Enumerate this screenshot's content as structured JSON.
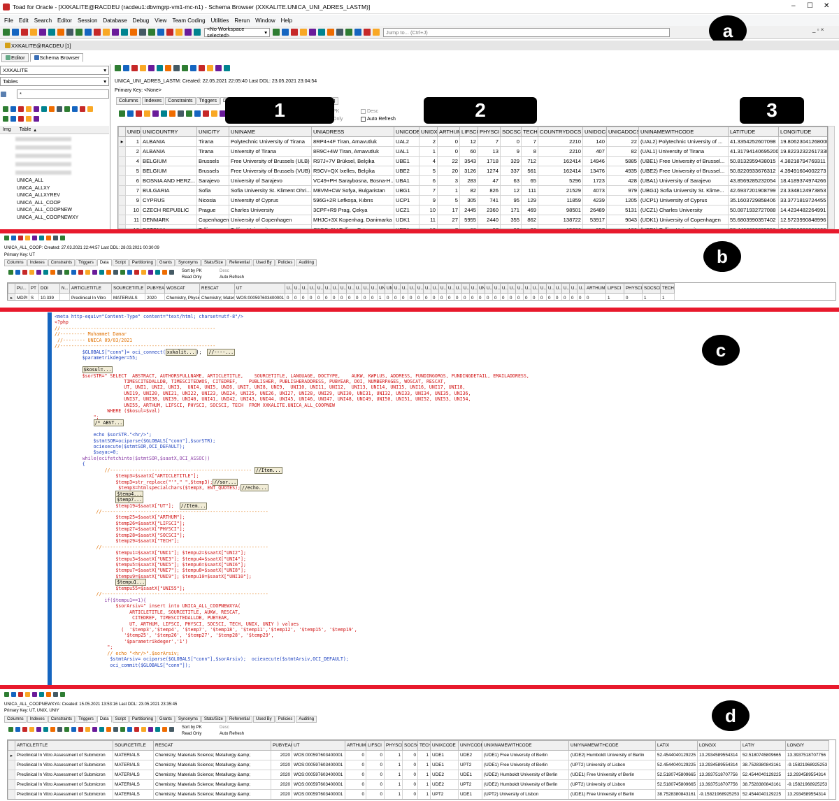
{
  "window": {
    "title": "Toad for Oracle - [XXKALITE@RACDEU (racdeu1:dbvmgrp-vm1-mc-n1) - Schema Browser (XXKALITE.UNICA_UNI_ADRES_LASTM)]",
    "controls": [
      "–",
      "☐",
      "✕"
    ]
  },
  "menu": [
    "File",
    "Edit",
    "Search",
    "Editor",
    "Session",
    "Database",
    "Debug",
    "View",
    "Team Coding",
    "Utilities",
    "Rerun",
    "Window",
    "Help"
  ],
  "toolbar": {
    "workspace": "<No Workspace selected>",
    "jump_placeholder": "Jump to... (Ctrl+J)"
  },
  "connection_tab": "XXKALITE@RACDEU [1]",
  "doc_tabs": [
    "Editor",
    "Schema Browser"
  ],
  "left": {
    "schema": "XXKALITE",
    "object_type": "Tables",
    "filter": "*",
    "col_img": "Img",
    "col_table": "Table",
    "tables": [
      "UNICA_ALL",
      "UNICA_ALLXY",
      "UNICA_ALLXYREV",
      "UNICA_ALL_COOP",
      "UNICA_ALL_COOPNEW",
      "UNICA_ALL_COOPNEWXY"
    ]
  },
  "labels": {
    "a": "a",
    "b": "b",
    "c": "c",
    "d": "d",
    "one": "1",
    "two": "2",
    "three": "3"
  },
  "panel_a": {
    "object": "UNICA_UNI_ADRES_LASTM:",
    "created": "Created: 22.05.2021 22:05:40",
    "ddl": "Last DDL: 23.05.2021 23:04:54",
    "pk": "Primary Key: <None>",
    "tabs": [
      "Columns",
      "Indexes",
      "Constraints",
      "Triggers",
      "Data",
      "Referential",
      "Used By",
      "Policies",
      "Auditing"
    ],
    "opt_pk": "PK",
    "opt_readonly": "Only",
    "opt_desc": "Desc",
    "opt_refresh": "Auto Refresh",
    "columns": [
      "UNID",
      "UNICOUNTRY",
      "UNICITY",
      "UNINAME",
      "UNIADRESS",
      "UNICODE",
      "UNIDX",
      "ARTHUM",
      "LIFSCI",
      "PHYSCI",
      "SOCSCI",
      "TECH",
      "COUNTRYDOCS",
      "UNIDOCS",
      "UNICADOCS",
      "UNINAMEWITHCODE",
      "LATITUDE",
      "LONGITUDE"
    ],
    "rows": [
      [
        "1",
        "ALBANIA",
        "Tirana",
        "Polytechnic University of Tirana",
        "8RP4+4F Tiran, Arnavutluk",
        "UAL2",
        "2",
        "0",
        "12",
        "7",
        "0",
        "7",
        "2210",
        "140",
        "22",
        "(UAL2) Polytechnic University of ...",
        "41.3354252607098",
        "19.80623041268000"
      ],
      [
        "2",
        "ALBANIA",
        "Tirana",
        "University of Tirana",
        "8R9C+4W Tiran, Arnavutluk",
        "UAL1",
        "1",
        "0",
        "60",
        "13",
        "9",
        "8",
        "2210",
        "407",
        "82",
        "(UAL1) University of Tirana",
        "41.31794140695200",
        "19.82232322617330"
      ],
      [
        "4",
        "BELGIUM",
        "Brussels",
        "Free University of Brussels (ULB)",
        "R97J+7V Brüksel, Belçika",
        "UBE1",
        "4",
        "22",
        "3543",
        "1718",
        "329",
        "712",
        "162414",
        "14946",
        "5885",
        "(UBE1) Free University of Brussel...",
        "50.8132959438015",
        "4.38218794769311"
      ],
      [
        "5",
        "BELGIUM",
        "Brussels",
        "Free University of Brussels (VUB)",
        "R9CV+QX Ixelles, Belçika",
        "UBE2",
        "5",
        "20",
        "3126",
        "1274",
        "337",
        "561",
        "162414",
        "13476",
        "4935",
        "(UBE2) Free University of Brussel...",
        "50.8220933676312",
        "4.39491604002273"
      ],
      [
        "6",
        "BOSNIA AND HERZ...",
        "Sarajevo",
        "University of Sarajevo",
        "VC49+PH Saraybosna, Bosna-H...",
        "UBA1",
        "6",
        "3",
        "283",
        "47",
        "63",
        "65",
        "5296",
        "1723",
        "428",
        "(UBA1) University of Sarajevo",
        "43.8569285232054",
        "18.4189374974266"
      ],
      [
        "7",
        "BULGARIA",
        "Sofia",
        "Sofia University St. Kliment Ohri...",
        "M8VM+CW Sofya, Bulgaristan",
        "UBG1",
        "7",
        "1",
        "82",
        "826",
        "12",
        "111",
        "21529",
        "4073",
        "979",
        "(UBG1) Sofia University St. Klime...",
        "42.6937201908799",
        "23.3348124973853"
      ],
      [
        "9",
        "CYPRUS",
        "Nicosia",
        "University of Cyprus",
        "596G+2R Lefkoşa, Kıbrıs",
        "UCP1",
        "9",
        "5",
        "305",
        "741",
        "95",
        "129",
        "11859",
        "4239",
        "1205",
        "(UCP1) University of Cyprus",
        "35.1603729858406",
        "33.3771819724455"
      ],
      [
        "10",
        "CZECH REPUBLIC",
        "Prague",
        "Charles University",
        "3CPF+R9 Prag, Çekya",
        "UCZ1",
        "10",
        "17",
        "2445",
        "2360",
        "171",
        "469",
        "98501",
        "26489",
        "5131",
        "(UCZ1) Charles University",
        "50.0871932727088",
        "14.4234482264991"
      ],
      [
        "11",
        "DENMARK",
        "Copenhagen",
        "University of Copenhagen",
        "MHJC+3X Kopenhag, Danimarka",
        "UDK1",
        "11",
        "27",
        "5955",
        "2440",
        "355",
        "862",
        "138722",
        "53917",
        "9043",
        "(UDK1) University of Copenhagen",
        "55.6803990357402",
        "12.5723990848996"
      ],
      [
        "12",
        "ESTONIA",
        "Tallinn",
        "Tallinn University",
        "C9QC+5H Tallinn, Estonya",
        "UEE1",
        "12",
        "7",
        "68",
        "27",
        "90",
        "22",
        "15236",
        "957",
        "186",
        "(UEE1) Tallinn University",
        "59.4460003295556",
        "24.7713299366630"
      ]
    ]
  },
  "panel_b": {
    "object": "UNICA_ALL_COOP:",
    "created": "Created: 27.03.2021 22:44:57",
    "ddl": "Last DDL: 28.03.2021 00:30:09",
    "pk": "Primary Key: UT",
    "tabs": [
      "Columns",
      "Indexes",
      "Constraints",
      "Triggers",
      "Data",
      "Script",
      "Partitioning",
      "Grants",
      "Synonyms",
      "Stats/Size",
      "Referential",
      "Used By",
      "Policies",
      "Auditing"
    ],
    "opt_sortpk": "Sort by PK",
    "opt_readonly": "Read Only",
    "opt_desc": "Desc",
    "opt_refresh": "Auto Refresh",
    "columns": [
      "PU...",
      "PT",
      "DOI",
      "N...",
      "ARTICLETITLE",
      "SOURCETITLE",
      "PUBYEAR",
      "WOSCAT",
      "RESCAT",
      "UT",
      "U...",
      "U...",
      "U...",
      "U...",
      "U...",
      "U...",
      "U...",
      "U...",
      "U...",
      "U...",
      "U...",
      "U...",
      "UNI18",
      "UNI19",
      "U...",
      "U...",
      "U...",
      "U...",
      "U...",
      "U...",
      "U...",
      "U...",
      "U...",
      "U...",
      "U...",
      "UNI37",
      "U...",
      "U...",
      "U...",
      "U...",
      "U...",
      "U...",
      "U...",
      "U...",
      "U...",
      "U...",
      "U...",
      "U...",
      "U...",
      "ARTHUM",
      "LIFSCI",
      "PHYSCI",
      "SOCSCI",
      "TECH"
    ],
    "row": [
      "MDPI",
      "S",
      "10.339",
      "",
      "Preclinical In Vitro",
      "MATERIALS",
      "2020",
      "Chemistry, Physic",
      "Chemistry; Material",
      "WOS:000597603400001",
      "0",
      "0",
      "0",
      "0",
      "0",
      "0",
      "0",
      "0",
      "0",
      "0",
      "0",
      "0",
      "1",
      "0",
      "0",
      "0",
      "0",
      "0",
      "0",
      "0",
      "0",
      "0",
      "0",
      "0",
      "0",
      "0",
      "0",
      "0",
      "0",
      "0",
      "0",
      "0",
      "0",
      "0",
      "0",
      "0",
      "0",
      "0",
      "0",
      "0",
      "1",
      "0",
      "1",
      "1"
    ]
  },
  "code": {
    "l01": "<meta http-equiv=\"Content-Type\" content=\"text/html; charset=utf-8\"/>",
    "l02": "<?php",
    "l03": "//--------------------------------------------------------",
    "l04": "//--------- Muhammet Damar",
    "l05": " //-------- UNICA 09/03/2021",
    "l06": "//--------------------------------------------------------",
    "l07a": "          $GLOBALS[\"conn\"]= oci_connect(",
    "l07b": "xxkalit...",
    "l07c": "//----...",
    "l08": "          $parametrikdeger=55;",
    "l10": "$kosul=...",
    "l11": "          $sorSTR=\" SELECT  ABSTRACT, AUTHORSFULLNAME, ARTICLETITLE,    SOURCETITLE, LANGUAGE, DOCTYPE,    AUKW, KWPLUS, ADDRESS, FUNDINGORGS, FUNDINGDETAIL, EMAILADDRESS,",
    "l12": "                         TIMESCITEDALLDB, TIMESCITEDWOS, CITEDREF,    PUBLISHER, PUBLISHERADDRESS, PUBYEAR, DOI, NUMBERPAGES, WOSCAT, RESCAT,",
    "l13": "                         UT, UNI1, UNI2, UNI3,  UNI4, UNI5, UNI6, UNI7, UNI8, UNI9,  UNI10, UNI11, UNI12,  UNI13, UNI14, UNI15, UNI16, UNI17, UNI18,",
    "l14": "                         UNI19, UNI20, UNI21, UNI22, UNI23, UNI24, UNI25, UNI26, UNI27, UNI28, UNI29, UNI30, UNI31, UNI32, UNI33, UNI34, UNI35, UNI36,",
    "l15": "                         UNI37, UNI38, UNI39, UNI40, UNI41, UNI42, UNI43, UNI44, UNI45, UNI46, UNI47, UNI48, UNI49, UNI50, UNI51, UNI52, UNI53, UNI54,",
    "l16": "                         UNI55, ARTHUM, LIFSCI, PHYSCI, SOCSCI, TECH  FROM XXKALITE.UNICA_ALL_COOPNEW",
    "l17": "                   WHERE ($kosul=$val)",
    "l18": "              \";",
    "l19": "/* ABST...",
    "l21": "              echo $sorSTR.\"<hr/>\";",
    "l22": "              $stmtSOR=ociparse($GLOBALS[\"conn\"],$sorSTR);",
    "l23": "              ociexecute($stmtSOR,OCI_DEFAULT);",
    "l24": "              $sayac=0;",
    "l25": "          while(ocifetchinto($stmtSOR,$saatX,OCI_ASSOC))",
    "l26": "          {",
    "l27": "                  //--------------------------------------------------- ",
    "l27b": "//Item...",
    "l28": "                      $temp3=$saatX[\"ARTICLETITLE\"];",
    "l29a": "                      $temp3=str_replace(\"'\",\" \",$temp3);",
    "l29b": "//sor...",
    "l30a": "                       $temp3=htmlspecialchars($temp3, ENT_QUOTES);",
    "l30b": "//echo...",
    "l31": "$temp4...",
    "l32": "$temp7...",
    "l33a": "                      $temp19=$saatX[\"UT\"];  ",
    "l33b": "//Item...",
    "l34": "               //------------------------------------------------------------",
    "l35": "                      $temp25=$saatX[\"ARTHUM\"];",
    "l36": "                      $temp26=$saatX[\"LIFSCI\"];",
    "l37": "                      $temp27=$saatX[\"PHYSCI\"];",
    "l38": "                      $temp28=$saatX[\"SOCSCI\"];",
    "l39": "                      $temp29=$saatX[\"TECH\"];",
    "l40": "               //------------------------------------------------------------",
    "l41": "                      $tempu1=$saatX[\"UNI1\"]; $tempu2=$saatX[\"UNI2\"];",
    "l42": "                      $tempu3=$saatX[\"UNI3\"]; $tempu4=$saatX[\"UNI4\"];",
    "l43": "                      $tempu5=$saatX[\"UNI5\"]; $tempu6=$saatX[\"UNI6\"];",
    "l44": "                      $tempu7=$saatX[\"UNI7\"]; $tempu8=$saatX[\"UNI8\"];",
    "l45": "                      $tempu9=$saatX[\"UNI9\"]; $tempu10=$saatX[\"UNI10\"];",
    "l46": "$tempu1...",
    "l47": "                      $tempu55=$saatX[\"UNI55\"];",
    "l48": "               //------------------------------------------------------------",
    "l49": "                  if($tempu1==1){",
    "l50": "                      $sorArsiv=\" insert into UNICA_ALL_COOPNEWXYA(",
    "l51": "                           ARTICLETITLE, SOURCETITLE, AUKW, RESCAT,",
    "l52": "                            CITEDREF, TIMESCITEDALLDB, PUBYEAR,",
    "l53": "                           UT, ARTHUM, LIFSCI, PHYSCI, SOCSCI, TECH, UNIX, UNIY ) values",
    "l54": "                        (  '$temp3','$temp4', '$temp7', '$temp18', '$temp11','$temp12', '$temp15', '$temp19',",
    "l55": "                         '$temp25', '$temp26', '$temp27', '$temp28', '$temp29',",
    "l56": "                         '$parametrikdeger','1')",
    "l57": "                   \";",
    "l58": "                   // echo \"<hr/>\".$sorArsiv;",
    "l59": "                    $stmtArsiv= ociparse($GLOBALS[\"conn\"],$sorArsiv);  ociexecute($stmtArsiv,OCI_DEFAULT);",
    "l60": "                    oci_commit($GLOBALS[\"conn\"]);"
  },
  "panel_d": {
    "object": "UNICA_ALL_COOPNEWXYA:",
    "created": "Created: 15.05.2021 13:53:16",
    "ddl": "Last DDL: 23.05.2021 23:35:45",
    "pk": "Primary Key: UT, UNIX, UNIY",
    "tabs": [
      "Columns",
      "Indexes",
      "Constraints",
      "Triggers",
      "Data",
      "Script",
      "Partitioning",
      "Grants",
      "Synonyms",
      "Stats/Size",
      "Referential",
      "Used By",
      "Policies",
      "Auditing"
    ],
    "opt_sortpk": "Sort by PK",
    "opt_readonly": "Read Only",
    "opt_desc": "Desc",
    "opt_refresh": "Auto Refresh",
    "columns": [
      "ARTICLETITLE",
      "SOURCETITLE",
      "RESCAT",
      "PUBYEAR",
      "UT",
      "ARTHUM",
      "LIFSCI",
      "PHYSCI",
      "SOCSCI",
      "TECH",
      "UNIXCODE",
      "UNIYCODE",
      "UNIXNAMEWITHCODE",
      "UNIYNAMEWITHCODE",
      "LATIX",
      "LONGIX",
      "LATIY",
      "LONGIY"
    ],
    "rows": [
      [
        "Preclinical In Vitro Assessment of Submicron",
        "MATERIALS",
        "Chemistry; Materials Science; Metallurgy &amp;",
        "2020",
        "WOS:000597603400001",
        "0",
        "0",
        "1",
        "0",
        "1",
        "UDE1",
        "UDE2",
        "(UDE1) Free University of Berlin",
        "(UDE2) Humboldt University of Berlin",
        "52.4544040129225",
        "13.2934589554314",
        "52.5180745809665",
        "13.3937518707756"
      ],
      [
        "Preclinical In Vitro Assessment of Submicron",
        "MATERIALS",
        "Chemistry; Materials Science; Metallurgy &amp;",
        "2020",
        "WOS:000597603400001",
        "0",
        "0",
        "1",
        "0",
        "1",
        "UDE1",
        "UPT2",
        "(UDE1) Free University of Berlin",
        "(UPT2) University of Lisbon",
        "52.4544040129225",
        "13.2934589554314",
        "38.7528380843161",
        "-9.15821968925253"
      ],
      [
        "Preclinical In Vitro Assessment of Submicron",
        "MATERIALS",
        "Chemistry; Materials Science; Metallurgy &amp;",
        "2020",
        "WOS:000597603400001",
        "0",
        "0",
        "1",
        "0",
        "1",
        "UDE2",
        "UDE1",
        "(UDE2) Humboldt University of Berlin",
        "(UDE1) Free University of Berlin",
        "52.5180745809665",
        "13.3937518707756",
        "52.4544040129225",
        "13.2934589554314"
      ],
      [
        "Preclinical In Vitro Assessment of Submicron",
        "MATERIALS",
        "Chemistry; Materials Science; Metallurgy &amp;",
        "2020",
        "WOS:000597603400001",
        "0",
        "0",
        "1",
        "0",
        "1",
        "UDE2",
        "UPT2",
        "(UDE2) Humboldt University of Berlin",
        "(UPT2) University of Lisbon",
        "52.5180745809665",
        "13.3937518707756",
        "38.7528380843161",
        "-9.15821968925253"
      ],
      [
        "Preclinical In Vitro Assessment of Submicron",
        "MATERIALS",
        "Chemistry; Materials Science; Metallurgy &amp;",
        "2020",
        "WOS:000597603400001",
        "0",
        "0",
        "1",
        "0",
        "1",
        "UPT2",
        "UDE1",
        "(UPT2) University of Lisbon",
        "(UDE1) Free University of Berlin",
        "38.7528380843161",
        "-9.15821968925253",
        "52.4544040129225",
        "13.2934589554314"
      ],
      [
        "Preclinical In Vitro Assessment of Submicron",
        "MATERIALS",
        "Chemistry; Materials Science; Metallurgy &amp;",
        "2020",
        "WOS:000597603400001",
        "0",
        "0",
        "1",
        "0",
        "1",
        "UPT2",
        "UDE2",
        "(UPT2) University of Lisbon",
        "(UDE2) Humboldt University of Berlin",
        "38.7528380843161",
        "-9.15821968925253",
        "52.5180745809665",
        "13.3937518707756"
      ]
    ]
  }
}
